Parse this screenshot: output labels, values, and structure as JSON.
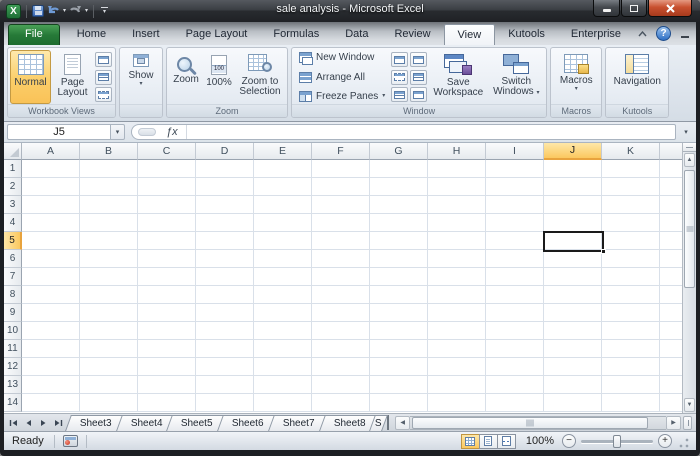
{
  "titlebar": {
    "title": "sale analysis  -  Microsoft Excel"
  },
  "tabs": {
    "items": [
      {
        "label": "File"
      },
      {
        "label": "Home"
      },
      {
        "label": "Insert"
      },
      {
        "label": "Page Layout"
      },
      {
        "label": "Formulas"
      },
      {
        "label": "Data"
      },
      {
        "label": "Review"
      },
      {
        "label": "View"
      },
      {
        "label": "Kutools"
      },
      {
        "label": "Enterprise"
      }
    ],
    "active": "View"
  },
  "ribbon": {
    "workbook_views": {
      "group_label": "Workbook Views",
      "normal": "Normal",
      "page_layout": "Page Layout"
    },
    "show": {
      "label": "Show",
      "group_label": ""
    },
    "zoom": {
      "group_label": "Zoom",
      "zoom": "Zoom",
      "hundred_percent": "100%",
      "zoom_to_selection": "Zoom to Selection"
    },
    "window": {
      "group_label": "Window",
      "new_window": "New Window",
      "arrange_all": "Arrange All",
      "freeze_panes": "Freeze Panes",
      "save_workspace": "Save Workspace",
      "switch_windows": "Switch Windows"
    },
    "macros": {
      "group_label": "Macros",
      "macros": "Macros"
    },
    "kutools": {
      "group_label": "Kutools",
      "navigation": "Navigation"
    }
  },
  "formula_bar": {
    "cell_reference": "J5",
    "fx_label": "ƒx"
  },
  "grid": {
    "columns": [
      "A",
      "B",
      "C",
      "D",
      "E",
      "F",
      "G",
      "H",
      "I",
      "J",
      "K"
    ],
    "rows": [
      "1",
      "2",
      "3",
      "4",
      "5",
      "6",
      "7",
      "8",
      "9",
      "10",
      "11",
      "12",
      "13",
      "14"
    ],
    "selected_column": "J",
    "selected_row": "5",
    "selected_cell": "J5"
  },
  "sheet_tabs": {
    "names": [
      "Sheet3",
      "Sheet4",
      "Sheet5",
      "Sheet6",
      "Sheet7",
      "Sheet8",
      "S"
    ]
  },
  "status_bar": {
    "mode": "Ready",
    "zoom_level": "100%"
  },
  "glyphs": {
    "dropdown": "▾",
    "up": "▲",
    "down": "▼",
    "left": "◀",
    "right": "▶",
    "help": "?",
    "excel_x": "X",
    "minus": "−",
    "plus": "+",
    "badge_100": "100"
  },
  "colors": {
    "selection_amber": "#fbc85f",
    "file_tab_green": "#267a38",
    "header_selected": "#fbc85f",
    "title_bar": "#2b2e33"
  },
  "icons": [
    "excel-logo-icon",
    "save-icon",
    "undo-icon",
    "redo-icon",
    "customize-quick-access-icon",
    "minimize-icon",
    "maximize-icon",
    "close-icon",
    "collapse-ribbon-icon",
    "help-icon",
    "normal-view-icon",
    "page-layout-view-icon",
    "page-break-preview-icon",
    "custom-views-icon",
    "full-screen-icon",
    "show-icon",
    "zoom-icon",
    "zoom-100-icon",
    "zoom-to-selection-icon",
    "new-window-icon",
    "arrange-all-icon",
    "freeze-panes-icon",
    "split-icon",
    "hide-icon",
    "unhide-icon",
    "view-side-by-side-icon",
    "synchronous-scrolling-icon",
    "reset-window-position-icon",
    "save-workspace-icon",
    "switch-windows-icon",
    "macros-icon",
    "navigation-icon",
    "select-all-icon",
    "macro-record-icon",
    "resize-grip-icon"
  ]
}
